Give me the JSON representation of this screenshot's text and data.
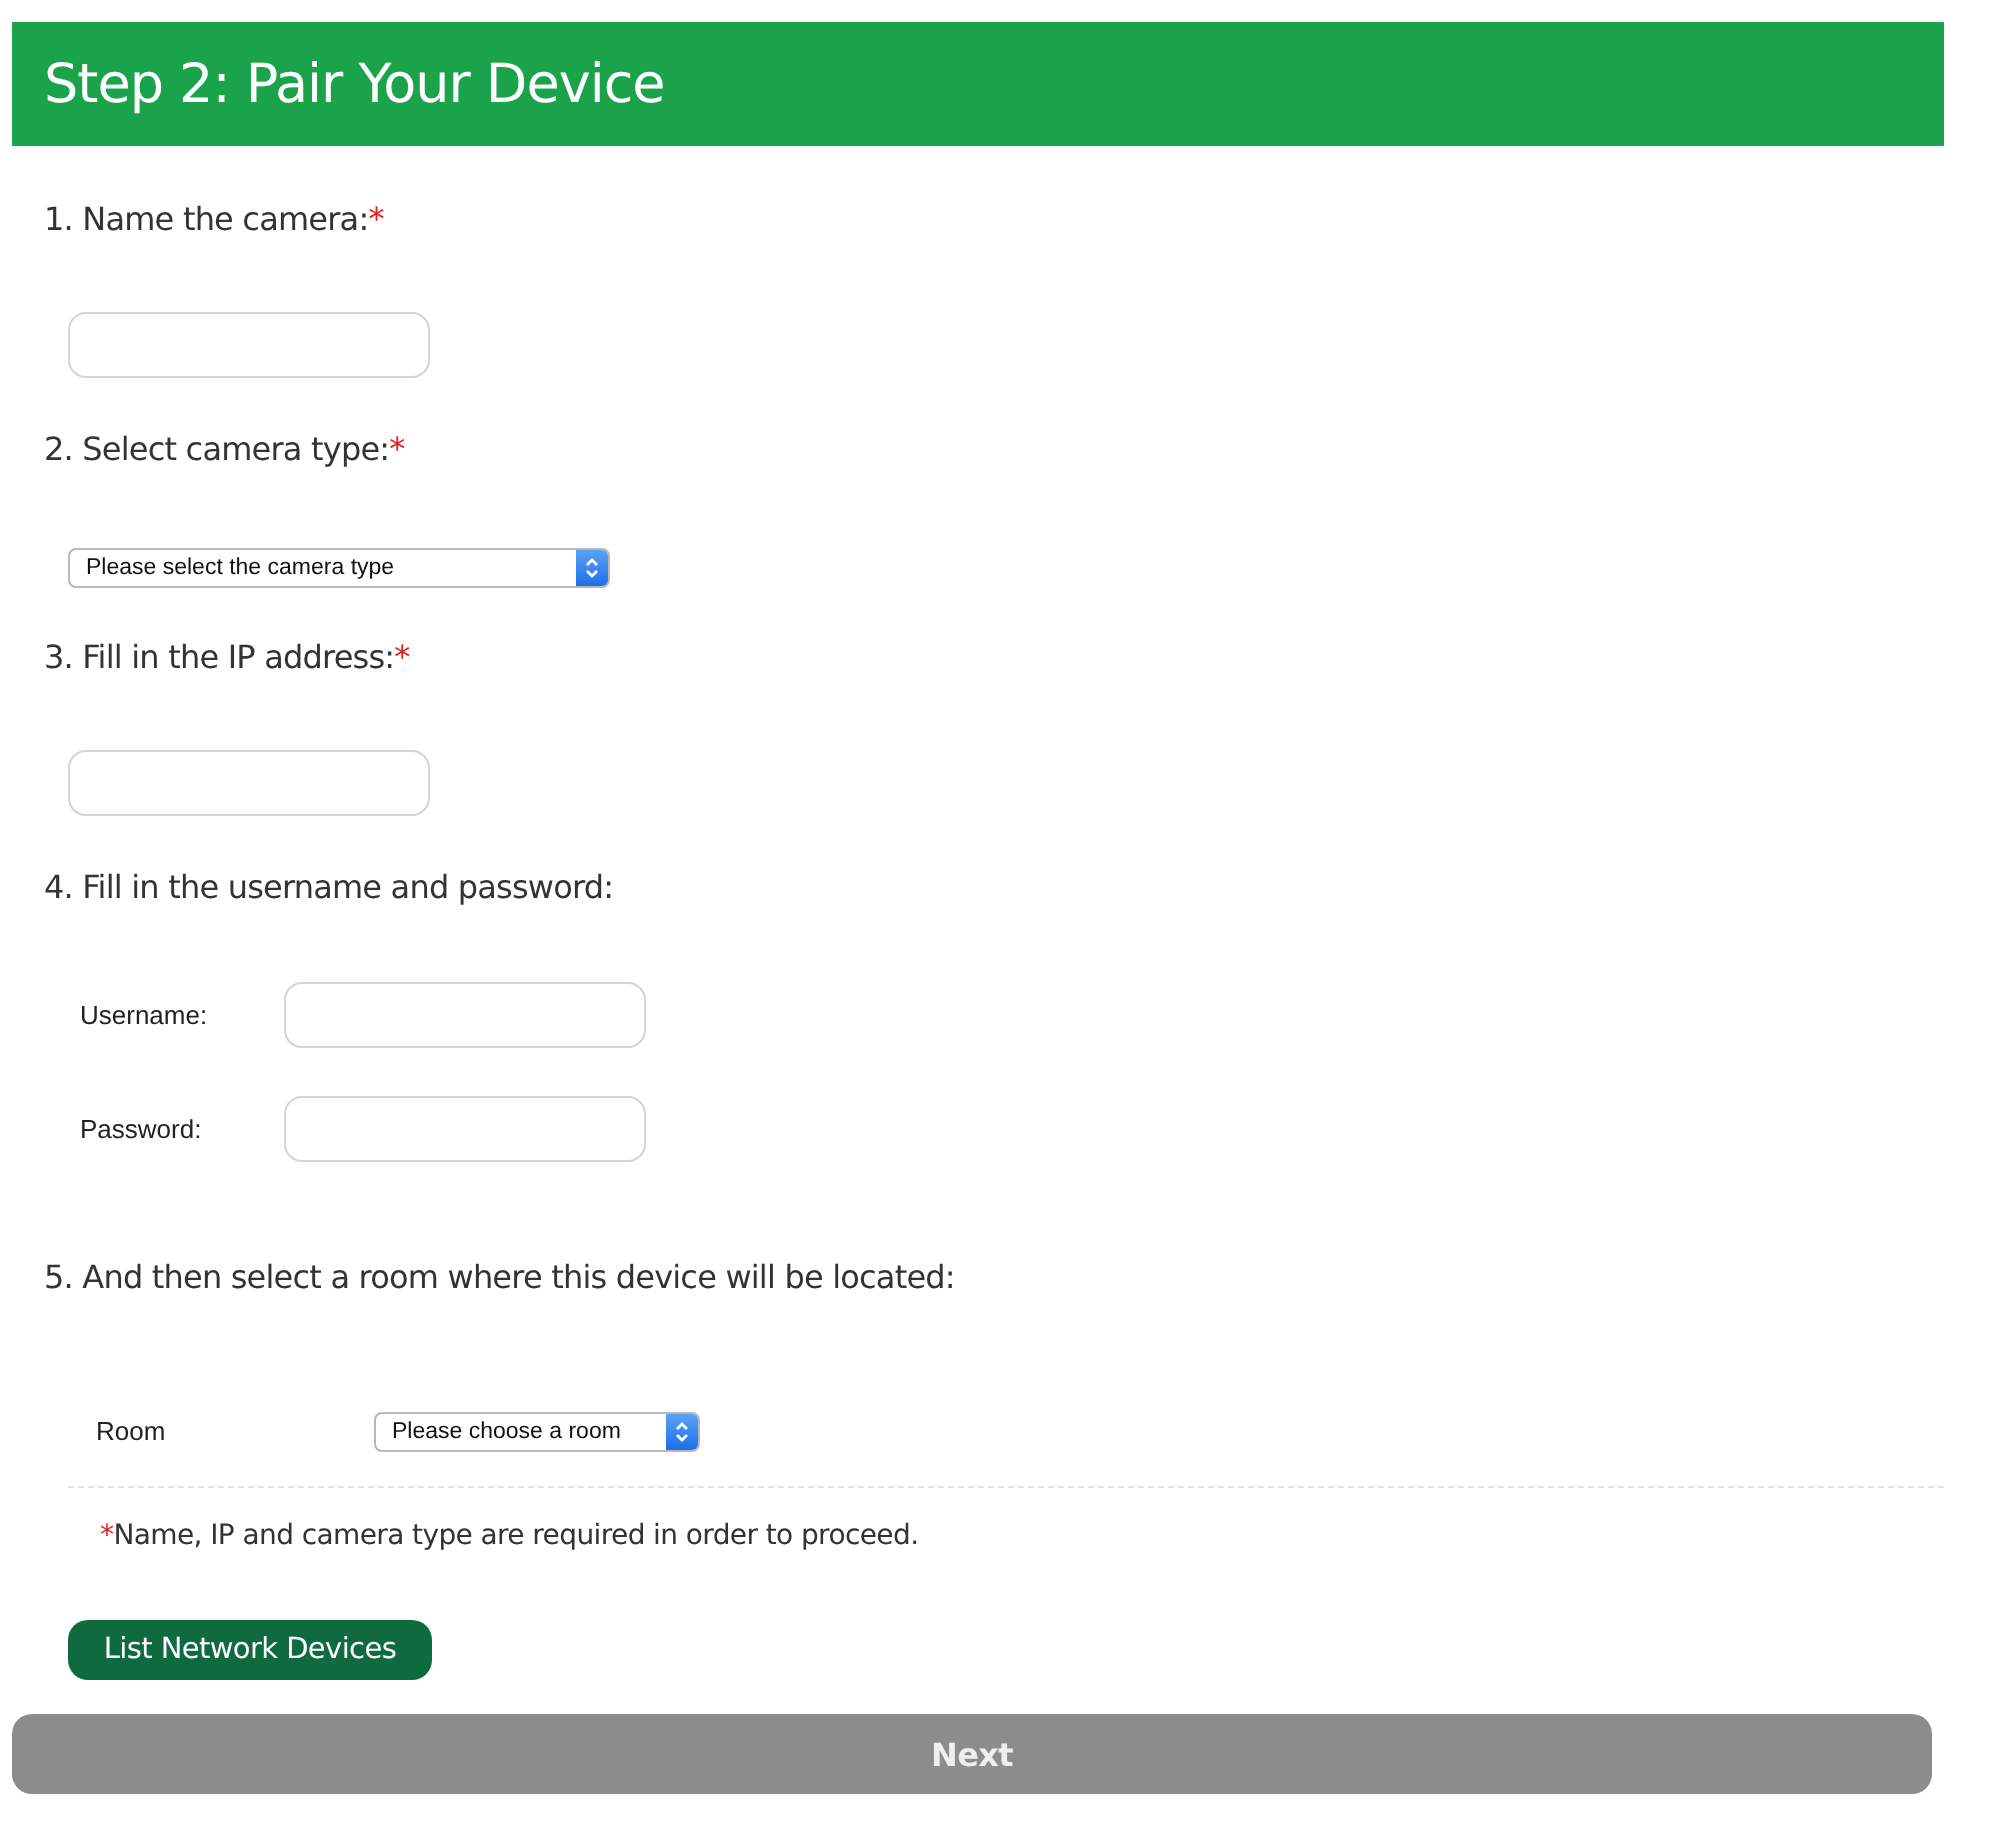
{
  "header": {
    "title": "Step 2: Pair Your Device"
  },
  "steps": [
    {
      "kind": "text",
      "label": "1. Name the camera:",
      "required_mark": "*"
    },
    {
      "kind": "select",
      "label": "2. Select camera type:",
      "required_mark": "*",
      "value": "Please select the camera type"
    },
    {
      "kind": "text",
      "label": "3. Fill in the IP address:",
      "required_mark": "*"
    },
    {
      "kind": "credentials",
      "label": "4. Fill in the username and password:",
      "fields": [
        {
          "label": "Username:"
        },
        {
          "label": "Password:"
        }
      ]
    },
    {
      "kind": "room",
      "label": "5. And then select a room where this device will be located:",
      "fields": [
        {
          "label": "Room",
          "value": "Please choose a room"
        }
      ]
    }
  ],
  "note": {
    "mark": "*",
    "text": "Name, IP and camera type are required in order to proceed."
  },
  "buttons": [
    {
      "kind": "secondary",
      "label": "List Network Devices"
    },
    {
      "kind": "primary",
      "label": "Next"
    }
  ]
}
